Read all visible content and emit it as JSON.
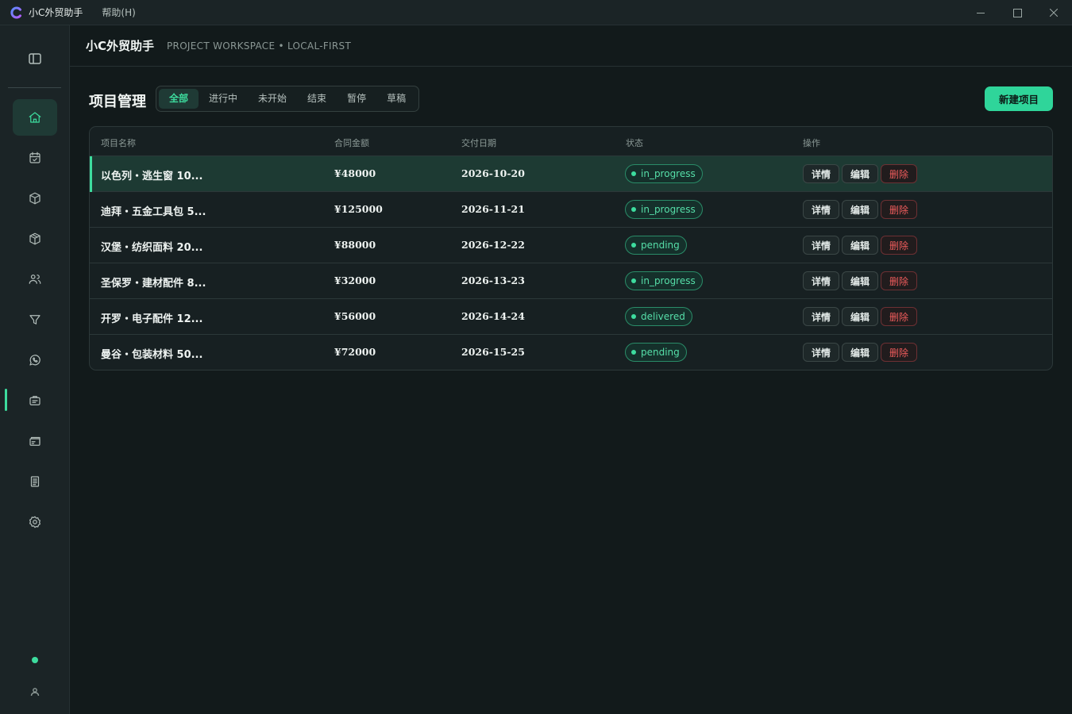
{
  "window": {
    "app_title": "小C外贸助手",
    "menu_help": "帮助(H)"
  },
  "header": {
    "title": "小C外贸助手",
    "subtitle": "PROJECT WORKSPACE  •  LOCAL-FIRST"
  },
  "sidebar": {
    "items": [
      {
        "icon": "home-icon"
      },
      {
        "icon": "calendar-check-icon"
      },
      {
        "icon": "box-icon"
      },
      {
        "icon": "package-icon"
      },
      {
        "icon": "users-icon"
      },
      {
        "icon": "filter-icon"
      },
      {
        "icon": "whatsapp-icon"
      },
      {
        "icon": "briefcase-icon"
      },
      {
        "icon": "cards-icon"
      },
      {
        "icon": "document-icon"
      },
      {
        "icon": "settings-icon"
      }
    ]
  },
  "page": {
    "title": "项目管理",
    "tabs": [
      "全部",
      "进行中",
      "未开始",
      "结束",
      "暂停",
      "草稿"
    ],
    "active_tab": "全部",
    "new_button": "新建项目"
  },
  "table": {
    "headers": {
      "name": "项目名称",
      "amount": "合同金额",
      "date": "交付日期",
      "status": "状态",
      "actions": "操作"
    },
    "action_labels": {
      "detail": "详情",
      "edit": "编辑",
      "delete": "删除"
    },
    "rows": [
      {
        "name": "以色列・逃生窗 10...",
        "amount": "¥48000",
        "date": "2026-10-20",
        "status": "in_progress"
      },
      {
        "name": "迪拜・五金工具包 5...",
        "amount": "¥125000",
        "date": "2026-11-21",
        "status": "in_progress"
      },
      {
        "name": "汉堡・纺织面料 20...",
        "amount": "¥88000",
        "date": "2026-12-22",
        "status": "pending"
      },
      {
        "name": "圣保罗・建材配件 8...",
        "amount": "¥32000",
        "date": "2026-13-23",
        "status": "in_progress"
      },
      {
        "name": "开罗・电子配件 12...",
        "amount": "¥56000",
        "date": "2026-14-24",
        "status": "delivered"
      },
      {
        "name": "曼谷・包装材料 50...",
        "amount": "¥72000",
        "date": "2026-15-25",
        "status": "pending"
      }
    ]
  },
  "colors": {
    "accent": "#3ddc9e",
    "background": "#121a1b",
    "sidebar": "#1b2426",
    "danger": "#ef5c5c"
  }
}
